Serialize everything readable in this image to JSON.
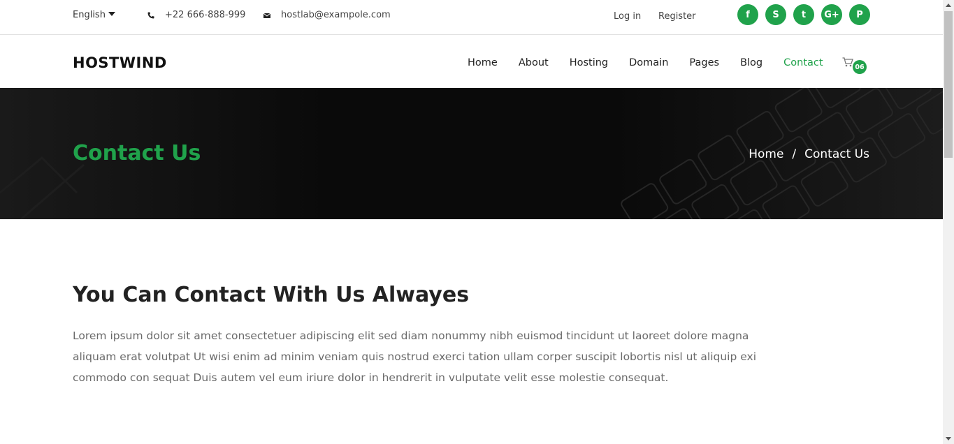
{
  "topbar": {
    "language": "English",
    "phone": "+22 666-888-999",
    "email": "hostlab@exampole.com",
    "login_label": "Log in",
    "register_label": "Register",
    "social": [
      {
        "name": "facebook-icon",
        "glyph": "f"
      },
      {
        "name": "skype-icon",
        "glyph": "S"
      },
      {
        "name": "twitter-icon",
        "glyph": "t"
      },
      {
        "name": "google-plus-icon",
        "glyph": "G+"
      },
      {
        "name": "pinterest-icon",
        "glyph": "P"
      }
    ]
  },
  "navbar": {
    "logo": "HOSTWIND",
    "menu": [
      {
        "label": "Home",
        "active": false
      },
      {
        "label": "About",
        "active": false
      },
      {
        "label": "Hosting",
        "active": false
      },
      {
        "label": "Domain",
        "active": false
      },
      {
        "label": "Pages",
        "active": false
      },
      {
        "label": "Blog",
        "active": false
      },
      {
        "label": "Contact",
        "active": true
      }
    ],
    "cart_icon": "cart-icon",
    "cart_count": "06"
  },
  "banner": {
    "title": "Contact Us",
    "breadcrumb": {
      "home": "Home",
      "separator": "/",
      "current": "Contact Us"
    }
  },
  "content": {
    "heading": "You Can Contact With Us Alwayes",
    "paragraph": "Lorem ipsum dolor sit amet consectetuer adipiscing elit sed diam nonummy nibh euismod tincidunt ut laoreet dolore magna aliquam erat volutpat Ut wisi enim ad minim veniam quis nostrud exerci tation ullam corper suscipit lobortis nisl ut aliquip exi commodo con sequat Duis autem vel eum iriure dolor in hendrerit in vulputate velit esse molestie consequat."
  },
  "colors": {
    "accent": "#20a24b",
    "banner_bg": "#0b0b0b"
  }
}
